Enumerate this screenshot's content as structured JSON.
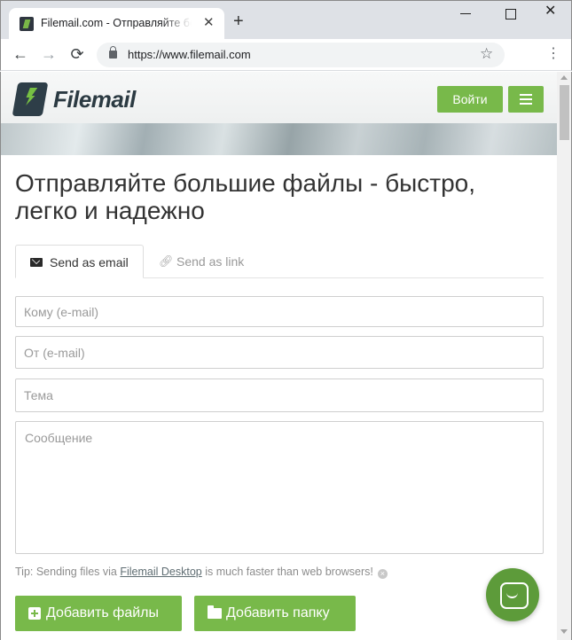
{
  "browser": {
    "tab_title": "Filemail.com - Отправляйте большие файлы",
    "tab_close_glyph": "✕",
    "new_tab_glyph": "+",
    "url": "https://www.filemail.com",
    "nav_back_glyph": "←",
    "nav_forward_glyph": "→",
    "nav_reload_glyph": "⟳",
    "star_glyph": "☆",
    "menu_glyph": "⋮",
    "close_glyph": "✕"
  },
  "header": {
    "logo_text": "Filemail",
    "login_label": "Войти"
  },
  "main": {
    "headline": "Отправляйте большие файлы - быстро, легко и надежно",
    "tabs": [
      {
        "label": "Send as email",
        "icon": "envelope-icon",
        "active": true
      },
      {
        "label": "Send as link",
        "icon": "link-icon",
        "active": false
      }
    ],
    "form": {
      "to_placeholder": "Кому (e-mail)",
      "from_placeholder": "От (e-mail)",
      "subject_placeholder": "Тема",
      "message_placeholder": "Сообщение"
    },
    "tip": {
      "prefix": "Tip: Sending files via ",
      "link": "Filemail Desktop",
      "suffix": " is much faster than web browsers!"
    },
    "buttons": {
      "add_files": "Добавить файлы",
      "add_folder": "Добавить папку"
    }
  },
  "colors": {
    "brand_green": "#78b94a",
    "chat_green": "#5d9b3a",
    "logo_dark": "#2b3a42"
  }
}
